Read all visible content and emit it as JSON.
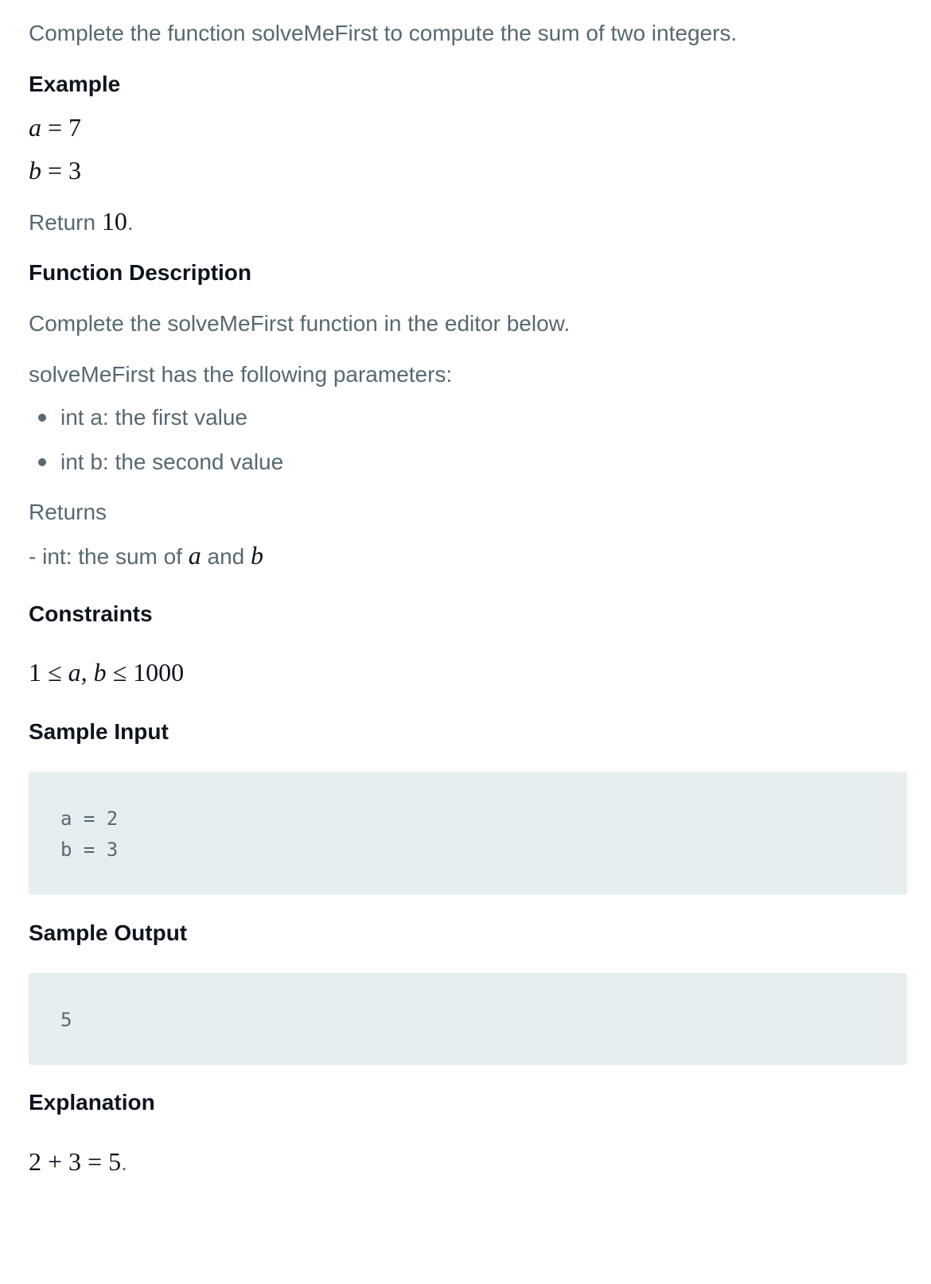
{
  "intro": "Complete the function solveMeFirst to compute the sum of two integers.",
  "example": {
    "heading": "Example",
    "a_var": "a",
    "a_eq": " = 7",
    "b_var": "b",
    "b_eq": " = 3",
    "return_prefix": "Return ",
    "return_value": "10",
    "return_suffix": "."
  },
  "function_description": {
    "heading": "Function Description",
    "text": "Complete the solveMeFirst function in the editor below.",
    "params_intro": "solveMeFirst has the following parameters:",
    "params": [
      "int a: the first value",
      "int b: the second value"
    ],
    "returns_label": "Returns",
    "returns_prefix": "- int: the sum of ",
    "returns_var_a": "a",
    "returns_and": " and ",
    "returns_var_b": "b"
  },
  "constraints": {
    "heading": "Constraints",
    "lower": "1 ≤ ",
    "vars": "a, b",
    "upper": " ≤ 1000"
  },
  "sample_input": {
    "heading": "Sample Input",
    "lines": [
      "a = 2",
      "b = 3"
    ]
  },
  "sample_output": {
    "heading": "Sample Output",
    "lines": [
      "5"
    ]
  },
  "explanation": {
    "heading": "Explanation",
    "math": "2 + 3 = 5",
    "suffix": "."
  },
  "colors": {
    "body_text": "#576871",
    "heading_text": "#0e141e",
    "code_background": "#e7eeef"
  }
}
